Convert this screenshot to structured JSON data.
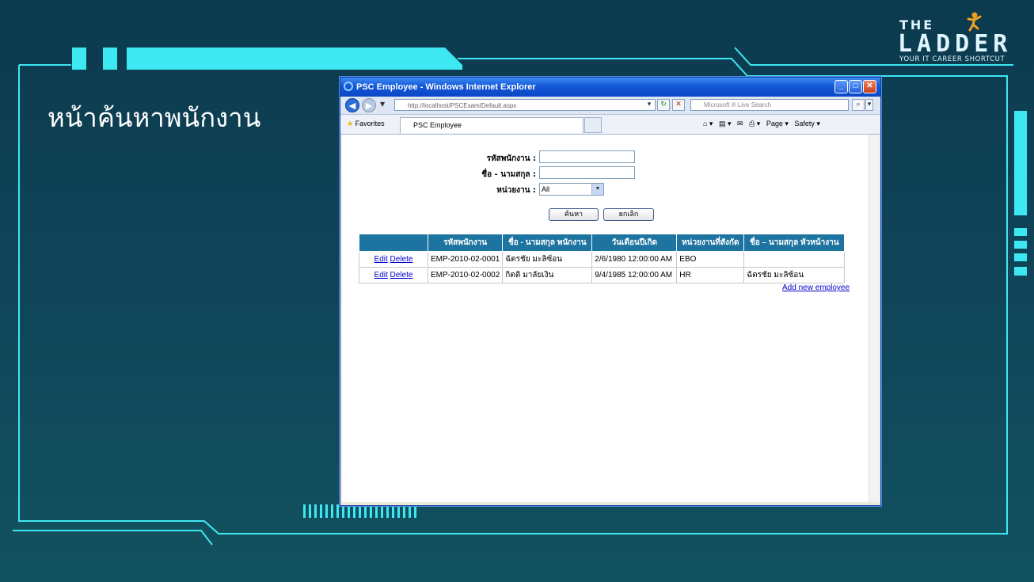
{
  "slide": {
    "title": "หน้าค้นหาพนักงาน",
    "logo": {
      "the": "THE",
      "ladder": "LADDER",
      "tagline": "YOUR IT CAREER SHORTCUT"
    },
    "colors": {
      "accent": "#3de8f2",
      "background": "#0e4155"
    }
  },
  "browser": {
    "window_title": "PSC Employee - Windows Internet Explorer",
    "address": "http://localhost/PSCExam/Default.aspx",
    "search_placeholder": "Microsoft ® Live Search",
    "favorites_label": "Favorites",
    "tab_label": "PSC Employee",
    "tools": {
      "page": "Page ▾",
      "safety": "Safety ▾"
    }
  },
  "form": {
    "employee_id_label": "รหัสพนักงาน :",
    "name_label": "ชื่อ - นามสกุล :",
    "department_label": "หน่วยงาน :",
    "department_selected": "All",
    "search_button": "ค้นหา",
    "cancel_button": "ยกเลิก"
  },
  "table": {
    "headers": [
      "",
      "รหัสพนักงาน",
      "ชื่อ - นามสกุล พนักงาน",
      "วันเดือนปีเกิด",
      "หน่วยงานที่สังกัด",
      "ชื่อ – นามสกุล หัวหน้างาน"
    ],
    "edit_label": "Edit",
    "delete_label": "Delete",
    "rows": [
      {
        "id": "EMP-2010-02-0001",
        "name": "ฉัตรชัย มะลิซ้อน",
        "dob": "2/6/1980 12:00:00 AM",
        "dept": "EBO",
        "manager": ""
      },
      {
        "id": "EMP-2010-02-0002",
        "name": "กิตติ มาลัยเงิน",
        "dob": "9/4/1985 12:00:00 AM",
        "dept": "HR",
        "manager": "ฉัตรชัย มะลิซ้อน"
      }
    ],
    "add_new": "Add new employee"
  }
}
